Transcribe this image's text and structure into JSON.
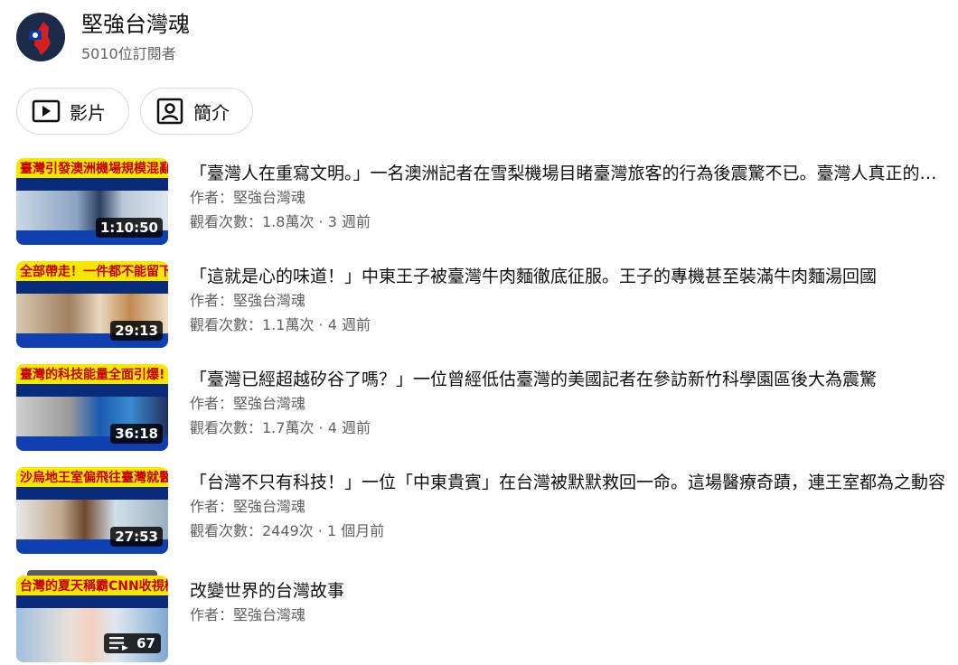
{
  "channel": {
    "name": "堅強台灣魂",
    "subscribers": "5010位訂閱者"
  },
  "tabs": [
    {
      "label": "影片",
      "icon": "play-icon"
    },
    {
      "label": "簡介",
      "icon": "profile-icon"
    }
  ],
  "videos": [
    {
      "thumb_text": "臺灣引發澳洲機場規模混亂!",
      "duration": "1:10:50",
      "title": "「臺灣人在重寫文明。」一名澳洲記者在雪梨機場目睹臺灣旅客的行為後震驚不已。臺灣人真正的模樣是什麼",
      "author": "作者：堅強台灣魂",
      "stats": "觀看次數：1.8萬次 · 3 週前"
    },
    {
      "thumb_text": "全部帶走！一件都不能留下!",
      "duration": "29:13",
      "title": "「這就是心的味道！」中東王子被臺灣牛肉麵徹底征服。王子的專機甚至裝滿牛肉麵湯回國",
      "author": "作者：堅強台灣魂",
      "stats": "觀看次數：1.1萬次 · 4 週前"
    },
    {
      "thumb_text": "臺灣的科技能量全面引爆!",
      "duration": "36:18",
      "title": "「臺灣已經超越矽谷了嗎？」一位曾經低估臺灣的美國記者在參訪新竹科學園區後大為震驚",
      "author": "作者：堅強台灣魂",
      "stats": "觀看次數：1.7萬次 · 4 週前"
    },
    {
      "thumb_text": "沙烏地王室偏飛往臺灣就醫!",
      "duration": "27:53",
      "title": "「台灣不只有科技！」一位「中東貴賓」在台灣被默默救回一命。這場醫療奇蹟，連王室都為之動容",
      "author": "作者：堅強台灣魂",
      "stats": "觀看次數：2449次 · 1 個月前"
    }
  ],
  "playlist": {
    "thumb_text": "台灣的夏天稱霸CNN收視榜!",
    "count": "67",
    "title": "改變世界的台灣故事",
    "author": "作者：堅強台灣魂"
  }
}
